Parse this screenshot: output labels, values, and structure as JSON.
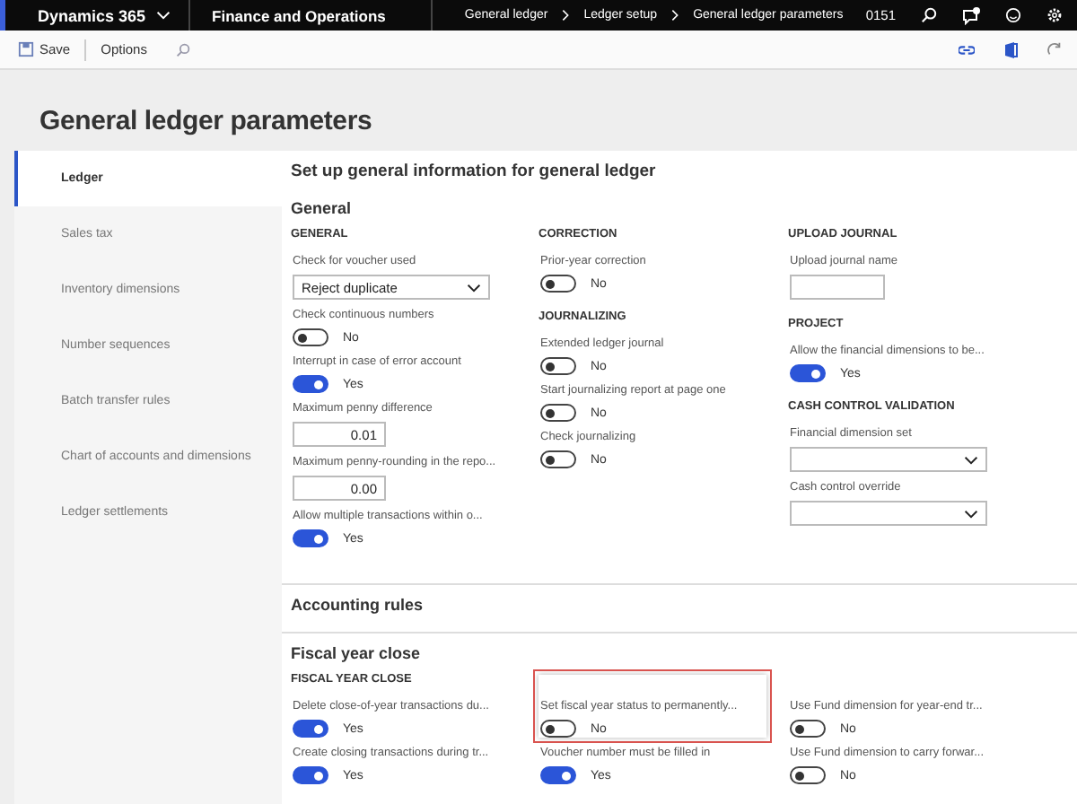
{
  "top_bar": {
    "app": "Dynamics 365",
    "module": "Finance and Operations",
    "breadcrumb": [
      "General ledger",
      "Ledger setup",
      "General ledger parameters"
    ],
    "company": "0151"
  },
  "toolbar": {
    "save": "Save",
    "options": "Options"
  },
  "page_title": "General ledger parameters",
  "nav": [
    {
      "label": "Ledger",
      "selected": true
    },
    {
      "label": "Sales tax",
      "selected": false
    },
    {
      "label": "Inventory dimensions",
      "selected": false
    },
    {
      "label": "Number sequences",
      "selected": false
    },
    {
      "label": "Batch transfer rules",
      "selected": false
    },
    {
      "label": "Chart of accounts and dimensions",
      "selected": false
    },
    {
      "label": "Ledger settlements",
      "selected": false
    }
  ],
  "content_heading": "Set up general information for general ledger",
  "sections": [
    {
      "title": "General",
      "columns": [
        {
          "groups": [
            {
              "heading": "GENERAL",
              "fields": [
                {
                  "kind": "select",
                  "label": "Check for voucher used",
                  "value": "Reject duplicate"
                },
                {
                  "kind": "toggle",
                  "label": "Check continuous numbers",
                  "on": false,
                  "value": "No"
                },
                {
                  "kind": "toggle",
                  "label": "Interrupt in case of error account",
                  "on": true,
                  "value": "Yes"
                },
                {
                  "kind": "number",
                  "label": "Maximum penny difference",
                  "value": "0.01"
                },
                {
                  "kind": "number",
                  "label": "Maximum penny-rounding in the repo...",
                  "value": "0.00"
                },
                {
                  "kind": "toggle",
                  "label": "Allow multiple transactions within o...",
                  "on": true,
                  "value": "Yes"
                }
              ]
            }
          ]
        },
        {
          "groups": [
            {
              "heading": "CORRECTION",
              "fields": [
                {
                  "kind": "toggle",
                  "label": "Prior-year correction",
                  "on": false,
                  "value": "No"
                }
              ]
            },
            {
              "heading": "JOURNALIZING",
              "fields": [
                {
                  "kind": "toggle",
                  "label": "Extended ledger journal",
                  "on": false,
                  "value": "No"
                },
                {
                  "kind": "toggle",
                  "label": "Start journalizing report at page one",
                  "on": false,
                  "value": "No"
                },
                {
                  "kind": "toggle",
                  "label": "Check journalizing",
                  "on": false,
                  "value": "No"
                }
              ]
            }
          ]
        },
        {
          "groups": [
            {
              "heading": "UPLOAD JOURNAL",
              "fields": [
                {
                  "kind": "text",
                  "label": "Upload journal name"
                }
              ]
            },
            {
              "heading": "PROJECT",
              "fields": [
                {
                  "kind": "toggle",
                  "label": "Allow the financial dimensions to be...",
                  "on": true,
                  "value": "Yes"
                }
              ]
            },
            {
              "heading": "CASH CONTROL VALIDATION",
              "fields": [
                {
                  "kind": "select",
                  "label": "Financial dimension set"
                },
                {
                  "kind": "select",
                  "label": "Cash control override"
                }
              ]
            }
          ]
        }
      ]
    },
    {
      "title": "Accounting rules"
    },
    {
      "title": "Fiscal year close",
      "columns": [
        {
          "groups": [
            {
              "heading": "FISCAL YEAR CLOSE",
              "fields": [
                {
                  "kind": "toggle",
                  "label": "Delete close-of-year transactions du...",
                  "on": true,
                  "value": "Yes"
                },
                {
                  "kind": "toggle",
                  "label": "Create closing transactions during tr...",
                  "on": true,
                  "value": "Yes"
                }
              ]
            }
          ]
        },
        {
          "groups": [
            {
              "fields": [
                {
                  "kind": "toggle",
                  "label": "Set fiscal year status to permanently...",
                  "on": false,
                  "value": "No",
                  "highlighted": true
                },
                {
                  "kind": "toggle",
                  "label": "Voucher number must be filled in",
                  "on": true,
                  "value": "Yes"
                }
              ]
            }
          ]
        },
        {
          "groups": [
            {
              "fields": [
                {
                  "kind": "toggle",
                  "label": "Use Fund dimension for year-end tr...",
                  "on": false,
                  "value": "No"
                },
                {
                  "kind": "toggle",
                  "label": "Use Fund dimension to carry forwar...",
                  "on": false,
                  "value": "No"
                }
              ]
            }
          ]
        }
      ]
    }
  ]
}
